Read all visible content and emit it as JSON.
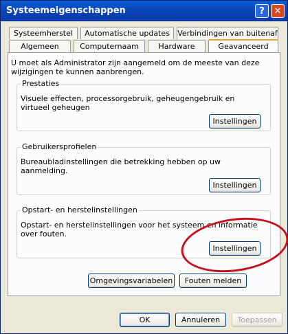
{
  "window": {
    "title": "Systeemeigenschappen"
  },
  "tabs": {
    "row_back": [
      "Systeemherstel",
      "Automatische updates",
      "Verbindingen van buitenaf"
    ],
    "row_front": [
      "Algemeen",
      "Computernaam",
      "Hardware",
      "Geavanceerd"
    ],
    "active": "Geavanceerd"
  },
  "panel": {
    "note": "U moet als Administrator zijn aangemeld om de meeste van deze wijzigingen te kunnen aanbrengen.",
    "groups": [
      {
        "legend": "Prestaties",
        "description": "Visuele effecten, processorgebruik, geheugengebruik en virtueel geheugen",
        "button": "Instellingen"
      },
      {
        "legend": "Gebruikersprofielen",
        "description": "Bureaubladinstellingen die betrekking hebben op uw aanmelding.",
        "button": "Instellingen"
      },
      {
        "legend": "Opstart- en herstelinstellingen",
        "description": "Opstart- en herstelinstellingen voor het systeem en informatie over fouten.",
        "button": "Instellingen"
      }
    ],
    "env_button": "Omgevingsvariabelen",
    "error_button": "Fouten melden"
  },
  "footer": {
    "ok": "OK",
    "cancel": "Annuleren",
    "apply": "Toepassen"
  },
  "colors": {
    "titlebar": "#0a47b8",
    "annotation_ring": "#c8101c",
    "active_tab_accent": "#f0a030"
  },
  "icons": {
    "help": "question-mark-icon",
    "close": "close-x-icon"
  }
}
